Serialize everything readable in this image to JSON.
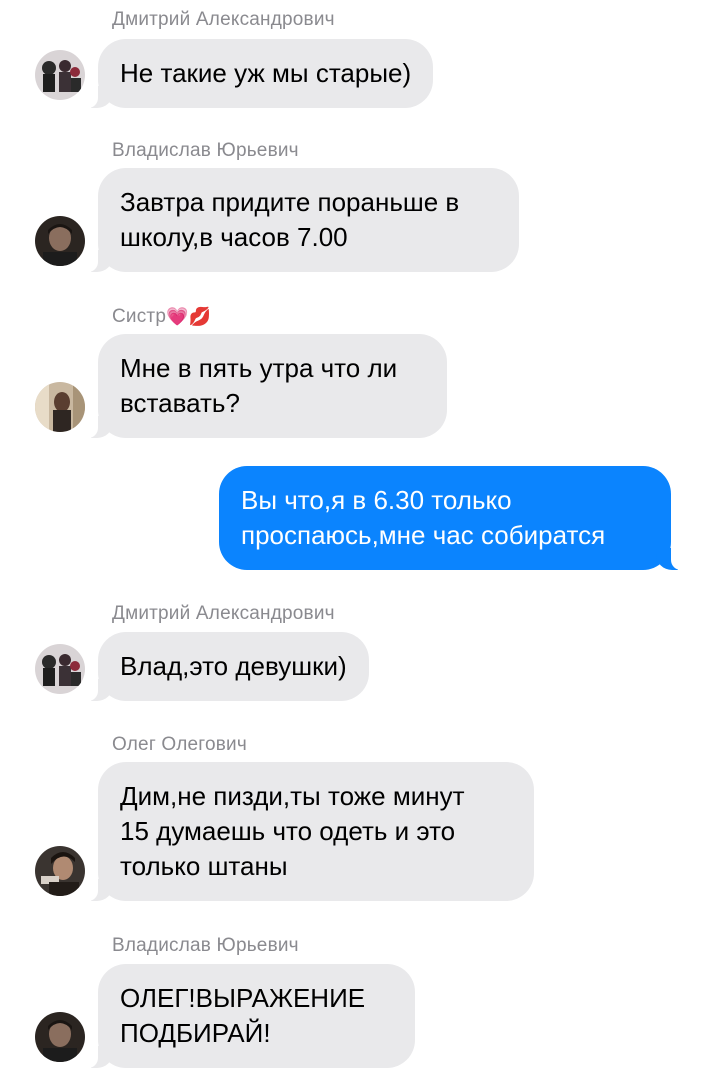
{
  "messages": [
    {
      "sender": "Дмитрий Александрович",
      "text": "Не такие уж мы старые)",
      "direction": "incoming",
      "avatar": "avatar-dmitry"
    },
    {
      "sender": "Владислав Юрьевич",
      "text": "Завтра придите пораньше в\nшколу,в часов 7.00",
      "direction": "incoming",
      "avatar": "avatar-vladislav"
    },
    {
      "sender": "Систр",
      "sender_emojis": "💗💋",
      "text": "Мне в пять утра что ли\nвставать?",
      "direction": "incoming",
      "avatar": "avatar-sistr"
    },
    {
      "text": "Вы что,я в 6.30 только\nпроспаюсь,мне час собиратся",
      "direction": "outgoing"
    },
    {
      "sender": "Дмитрий Александрович",
      "text": "Влад,это девушки)",
      "direction": "incoming",
      "avatar": "avatar-dmitry"
    },
    {
      "sender": "Олег Олегович",
      "text": "Дим,не пизди,ты тоже минут\n15 думаешь что одеть и это\nтолько штаны",
      "direction": "incoming",
      "avatar": "avatar-oleg"
    },
    {
      "sender": "Владислав Юрьевич",
      "text": "ОЛЕГ!ВЫРАЖЕНИЕ\nПОДБИРАЙ!",
      "direction": "incoming",
      "avatar": "avatar-vladislav"
    }
  ],
  "colors": {
    "incoming_bubble": "#e9e9eb",
    "outgoing_bubble": "#0b84fe",
    "sender_name": "#8a8a8f"
  }
}
